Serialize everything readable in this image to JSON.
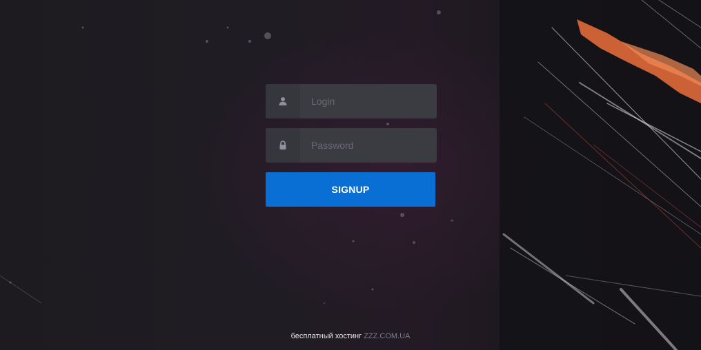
{
  "form": {
    "login_placeholder": "Login",
    "password_placeholder": "Password",
    "submit_label": "SIGNUP"
  },
  "footer": {
    "text": "бесплатный хостинг",
    "link_text": "ZZZ.COM.UA"
  },
  "icons": {
    "login": "user-icon",
    "password": "lock-icon"
  },
  "colors": {
    "background": "#1c1a1f",
    "field_bg": "#3a3c42",
    "button_bg": "#0a6fd4",
    "accent_streak": "#e06a3a"
  }
}
